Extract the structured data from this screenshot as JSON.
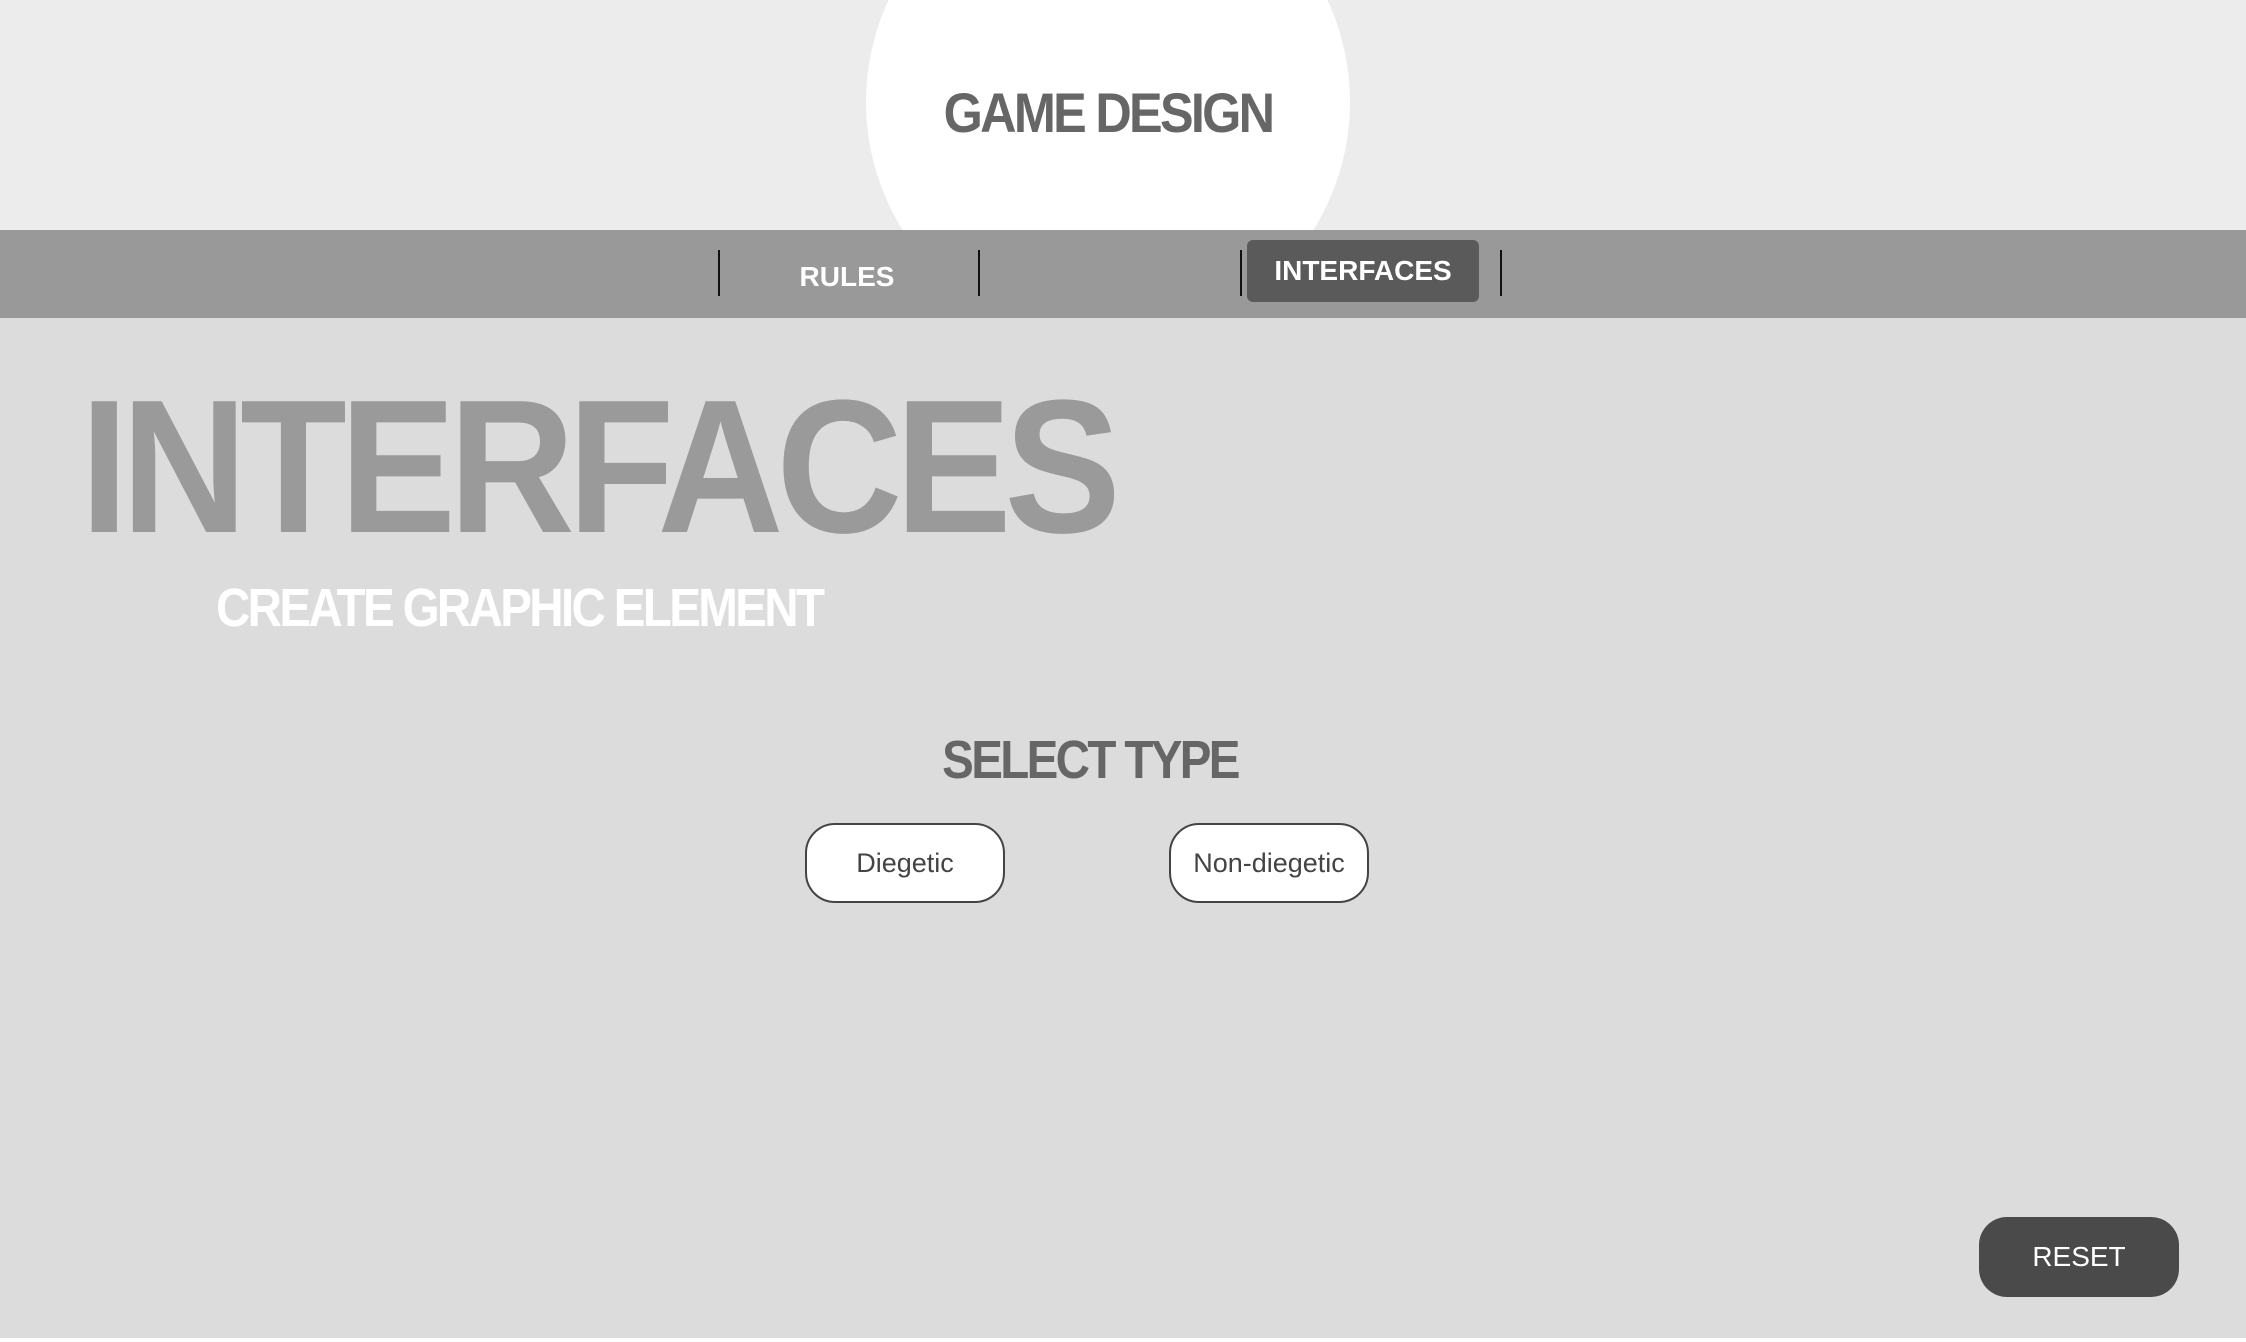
{
  "header": {
    "logo_text": "GAME DESIGN"
  },
  "nav": {
    "items": [
      {
        "label": "RULES",
        "active": false
      },
      {
        "label": "INTERFACES",
        "active": true
      }
    ]
  },
  "main": {
    "title": "INTERFACES",
    "subtitle": "CREATE GRAPHIC ELEMENT",
    "select_label": "SELECT TYPE",
    "types": [
      {
        "label": "Diegetic"
      },
      {
        "label": "Non-diegetic"
      }
    ]
  },
  "footer": {
    "reset_label": "RESET"
  },
  "colors": {
    "header_bg": "#ececec",
    "nav_bg": "#999999",
    "nav_active_bg": "#5a5a5a",
    "page_bg": "#dcdcdc",
    "title_color": "#9a9a9a",
    "reset_bg": "#4a4a4a"
  }
}
